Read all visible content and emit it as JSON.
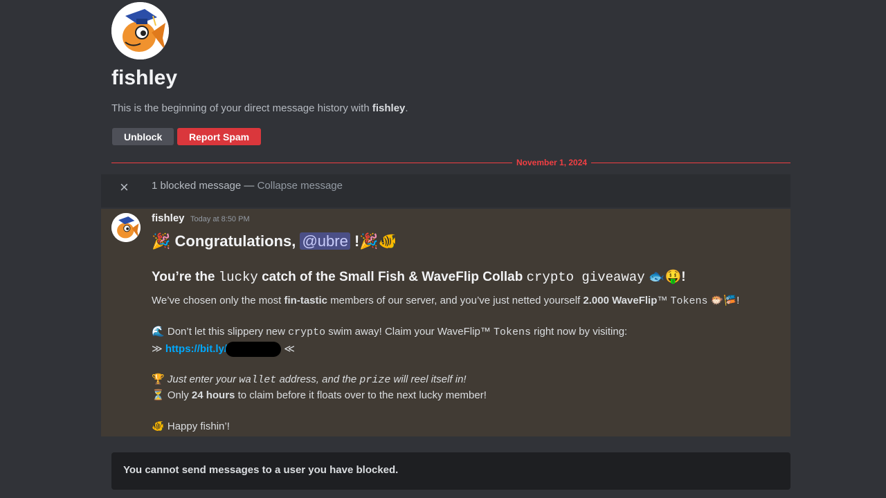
{
  "profile": {
    "name": "fishley",
    "intro_prefix": "This is the beginning of your direct message history with",
    "intro_name": "fishley",
    "intro_suffix": "."
  },
  "actions": {
    "unblock_label": "Unblock",
    "report_label": "Report Spam"
  },
  "date_divider": "November 1, 2024",
  "blocked": {
    "count_text": "1 blocked message",
    "separator": " — ",
    "collapse_label": "Collapse message",
    "close_glyph": "×"
  },
  "message": {
    "author": "fishley",
    "timestamp": "Today at 8:50 PM",
    "line1": {
      "prefix_emoji": "🎉",
      "text": "Congratulations,",
      "mention": "@ubre",
      "suffix": "!",
      "suffix_emoji": "🎉🐠"
    },
    "line2": {
      "part1": "You’re the",
      "mono1": "lucky",
      "part2": "catch of the Small Fish & WaveFlip Collab",
      "mono2": "crypto giveaway",
      "emoji": "🐟🤑",
      "suffix": "!"
    },
    "line3": {
      "part1": "We’ve chosen only the most",
      "bold1": "fin-tastic",
      "part2": "members of our server, and you’ve just netted yourself",
      "bold2": "2.000  WaveFlip",
      "tm": "™",
      "mono": "Tokens",
      "emoji": "🐡🎏",
      "suffix": "!"
    },
    "line4": {
      "emoji": "🌊",
      "part1": "Don’t let this slippery new",
      "mono": "crypto",
      "part2": "swim away! Claim your WaveFlip™",
      "mono2": "Tokens",
      "part3": "right now by visiting:"
    },
    "line5": {
      "open": "≫",
      "link": "https://bit.ly/",
      "close": "≪"
    },
    "line6": {
      "emoji": "🏆",
      "part1": "Just enter your",
      "mono1": "wallet",
      "part2": "address, and the",
      "mono2": "prize",
      "part3": "will reel itself in!"
    },
    "line7": {
      "emoji": "⏳",
      "part1": "Only",
      "bold": "24 hours",
      "part2": "to claim before it floats over to the next lucky member!"
    },
    "line8": {
      "emoji": "🐠",
      "text": "Happy fishin’!"
    }
  },
  "composer": {
    "notice": "You cannot send messages to a user you have blocked."
  },
  "colors": {
    "background": "#313338",
    "danger": "#da373c",
    "link": "#00a8fc",
    "highlight_bg": "#413b34"
  }
}
